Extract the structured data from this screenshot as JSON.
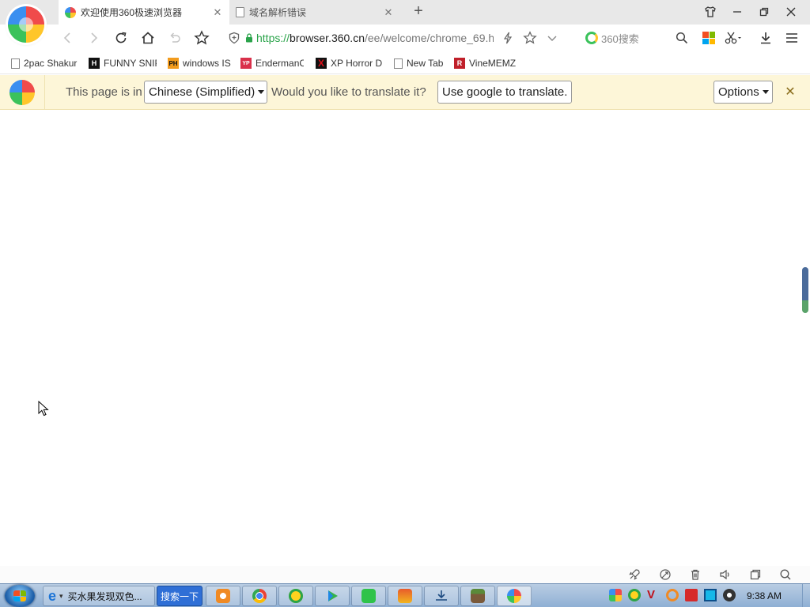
{
  "tabs": [
    {
      "title": "欢迎使用360极速浏览器",
      "active": true,
      "favicon": "360-logo-icon"
    },
    {
      "title": "域名解析错误",
      "active": false,
      "favicon": "page-icon"
    }
  ],
  "address": {
    "scheme": "https://",
    "host": "browser.360.cn",
    "path": "/ee/welcome/chrome_69.h"
  },
  "search": {
    "placeholder": "360搜索"
  },
  "bookmarks": [
    {
      "label": "2pac Shakur",
      "icon": "page-icon"
    },
    {
      "label": "FUNNY SNIP",
      "icon": "h-logo-icon",
      "color": "#111111",
      "glyph": "H"
    },
    {
      "label": "windows IS",
      "icon": "ph-logo-icon",
      "color": "#f29b1d",
      "glyph": "PH"
    },
    {
      "label": "EndermanC",
      "icon": "yt-logo-icon",
      "color": "#d9304b",
      "glyph": "YP"
    },
    {
      "label": "XP Horror D",
      "icon": "x-logo-icon",
      "color": "#c0101a",
      "glyph": "X"
    },
    {
      "label": "New Tab",
      "icon": "page-icon"
    },
    {
      "label": "VineMEMZ",
      "icon": "r-logo-icon",
      "color": "#c0202a",
      "glyph": "R"
    }
  ],
  "translate": {
    "prefix": "This page is in",
    "language": "Chinese (Simplified)",
    "question": "Would you like to translate it?",
    "translate_button": "Use google to translate.",
    "options": "Options"
  },
  "taskbar": {
    "ie_label": "买水果发现双色...",
    "search_button": "搜索一下",
    "clock": "9:38 AM"
  },
  "colors": {
    "accent_green": "#2aa34a",
    "translate_bar_bg": "#fdf6d8",
    "taskbar_bg": "#a9c2de"
  }
}
